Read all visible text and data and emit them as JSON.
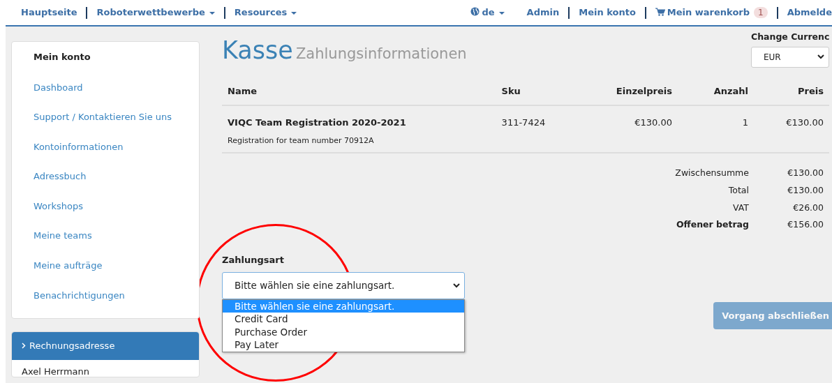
{
  "navbar": {
    "left": [
      {
        "label": "Hauptseite",
        "dropdown": false
      },
      {
        "label": "Roboterwettbewerbe",
        "dropdown": true
      },
      {
        "label": "Resources",
        "dropdown": true
      }
    ],
    "language": "de",
    "right": [
      {
        "label": "Admin",
        "kind": "link"
      },
      {
        "label": "Mein konto",
        "kind": "link"
      },
      {
        "label": "Mein warenkorb",
        "kind": "cart",
        "badge": "1"
      },
      {
        "label": "Abmelde",
        "kind": "link"
      }
    ]
  },
  "sidebar": {
    "title": "Mein konto",
    "items": [
      "Dashboard",
      "Support / Kontaktieren Sie uns",
      "Kontoinformationen",
      "Adressbuch",
      "Workshops",
      "Meine teams",
      "Meine aufträge",
      "Benachrichtigungen"
    ],
    "address_panel": {
      "title": "Rechnungsadresse",
      "lines": [
        "Axel Herrmann"
      ]
    }
  },
  "page": {
    "title": "Kasse",
    "subtitle": "Zahlungsinformationen"
  },
  "currency": {
    "label": "Change Currenc",
    "value": "EUR"
  },
  "table": {
    "columns": [
      "Name",
      "Sku",
      "Einzelpreis",
      "Anzahl",
      "Preis"
    ],
    "rows": [
      {
        "name": "VIQC Team Registration 2020-2021",
        "description": "Registration for team number 70912A",
        "sku": "311-7424",
        "unit_price": "€130.00",
        "quantity": "1",
        "price": "€130.00"
      }
    ]
  },
  "totals": [
    {
      "label": "Zwischensumme",
      "value": "€130.00",
      "bold": false
    },
    {
      "label": "Total",
      "value": "€130.00",
      "bold": false
    },
    {
      "label": "VAT",
      "value": "€26.00",
      "bold": false
    },
    {
      "label": "Offener betrag",
      "value": "€156.00",
      "bold": true
    }
  ],
  "payment": {
    "label": "Zahlungsart",
    "value": "Bitte wählen sie eine zahlungsart.",
    "expanded": true,
    "options": [
      {
        "label": "Bitte wählen sie eine zahlungsart.",
        "selected": true
      },
      {
        "label": "Credit Card",
        "selected": false
      },
      {
        "label": "Purchase Order",
        "selected": false
      },
      {
        "label": "Pay Later",
        "selected": false
      }
    ]
  },
  "submit": {
    "label": "Vorgang abschließen",
    "disabled": true
  }
}
